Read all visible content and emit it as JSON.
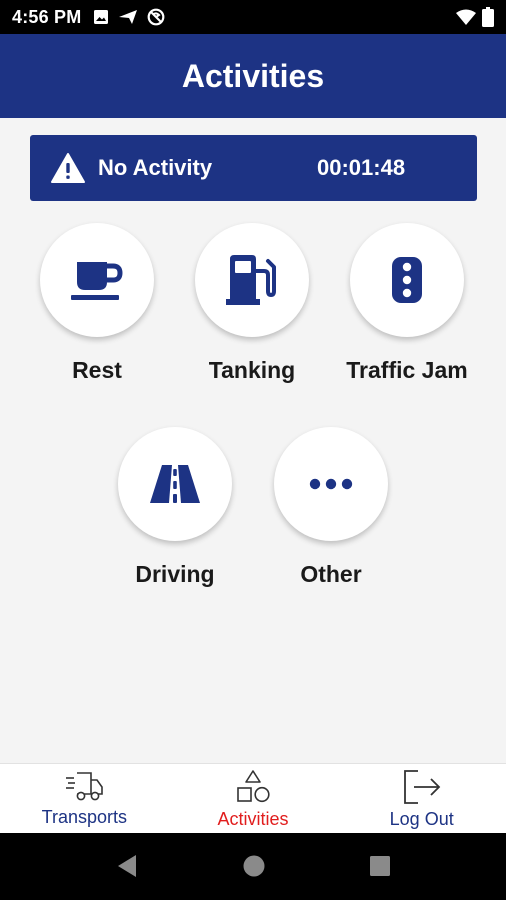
{
  "status_bar": {
    "time": "4:56 PM",
    "icons": [
      "image-icon",
      "navigation-icon",
      "no-sim-icon",
      "wifi-icon",
      "battery-icon"
    ]
  },
  "header": {
    "title": "Activities"
  },
  "banner": {
    "icon": "warning-icon",
    "status": "No Activity",
    "timer": "00:01:48"
  },
  "activities": [
    {
      "label": "Rest",
      "icon": "coffee-cup-icon"
    },
    {
      "label": "Tanking",
      "icon": "fuel-pump-icon"
    },
    {
      "label": "Traffic Jam",
      "icon": "traffic-light-icon"
    },
    {
      "label": "Driving",
      "icon": "road-icon"
    },
    {
      "label": "Other",
      "icon": "more-dots-icon"
    }
  ],
  "bottom_nav": [
    {
      "label": "Transports",
      "icon": "delivery-truck-icon",
      "active": false
    },
    {
      "label": "Activities",
      "icon": "shapes-icon",
      "active": true
    },
    {
      "label": "Log Out",
      "icon": "logout-icon",
      "active": false
    }
  ],
  "colors": {
    "primary": "#1d3384",
    "active_nav": "#e11d1d",
    "background": "#f4f4f4"
  }
}
